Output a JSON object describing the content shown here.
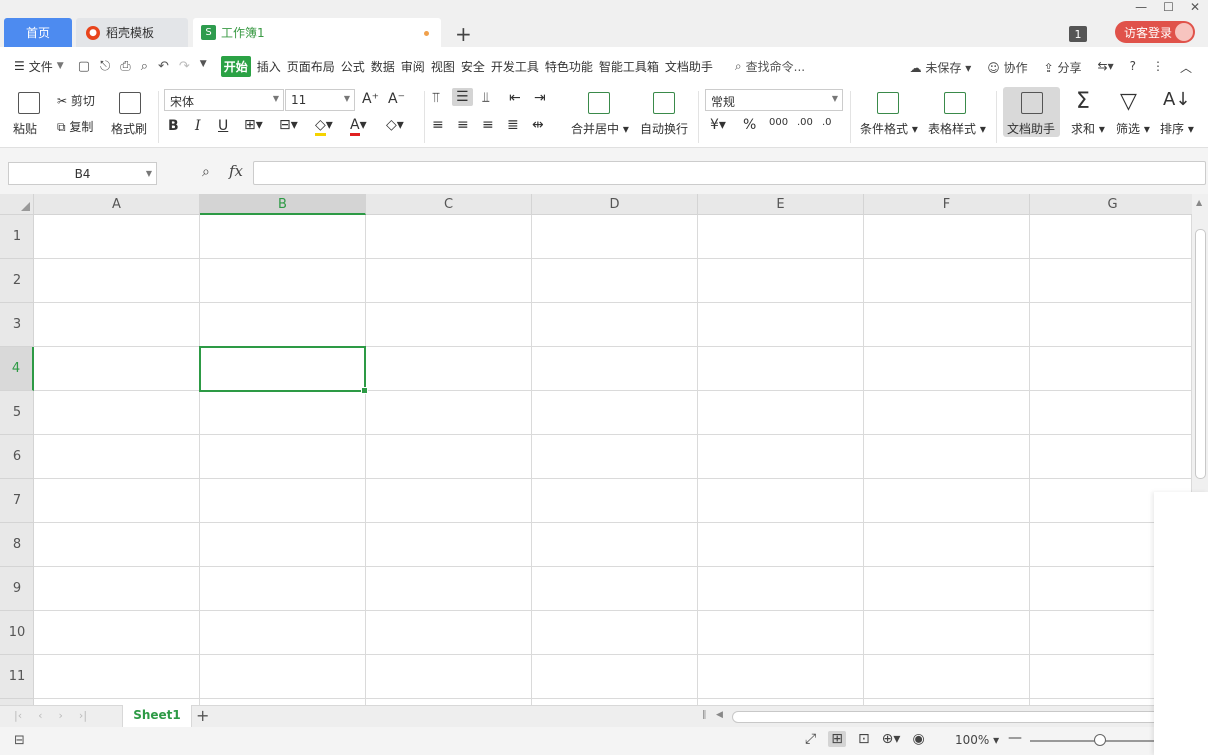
{
  "tabs": {
    "home": "首页",
    "docer": "稻壳模板",
    "workbook": "工作簿1",
    "add": "+"
  },
  "title_bar": {
    "page_count": "1",
    "login": "访客登录",
    "minimize": "—",
    "maximize": "☐",
    "close": "✕"
  },
  "menu": {
    "file": "文件",
    "items": [
      "开始",
      "插入",
      "页面布局",
      "公式",
      "数据",
      "审阅",
      "视图",
      "安全",
      "开发工具",
      "特色功能",
      "智能工具箱",
      "文档助手"
    ],
    "active_index": 0,
    "search": "查找命令...",
    "unsaved": "未保存",
    "collab": "协作",
    "share": "分享"
  },
  "ribbon": {
    "paste": "粘贴",
    "cut": "剪切",
    "copy": "复制",
    "format_painter": "格式刷",
    "font_name": "宋体",
    "font_size": "11",
    "merge_center": "合并居中",
    "wrap_text": "自动换行",
    "number_format": "常规",
    "conditional_format": "条件格式",
    "table_style": "表格样式",
    "doc_helper": "文档助手",
    "sum": "求和",
    "filter": "筛选",
    "sort": "排序"
  },
  "formula_bar": {
    "name_box": "B4",
    "fx": "fx",
    "value": ""
  },
  "grid": {
    "columns": [
      "A",
      "B",
      "C",
      "D",
      "E",
      "F",
      "G"
    ],
    "rows": [
      "1",
      "2",
      "3",
      "4",
      "5",
      "6",
      "7",
      "8",
      "9",
      "10",
      "11"
    ],
    "active_column": "B",
    "active_row": "4"
  },
  "sheets": {
    "tabs": [
      "Sheet1"
    ],
    "active": "Sheet1"
  },
  "status_bar": {
    "zoom": "100%"
  },
  "colors": {
    "accent_green": "#2d9a45",
    "home_tab_blue": "#4d8bf0",
    "login_red": "#e0524a"
  }
}
